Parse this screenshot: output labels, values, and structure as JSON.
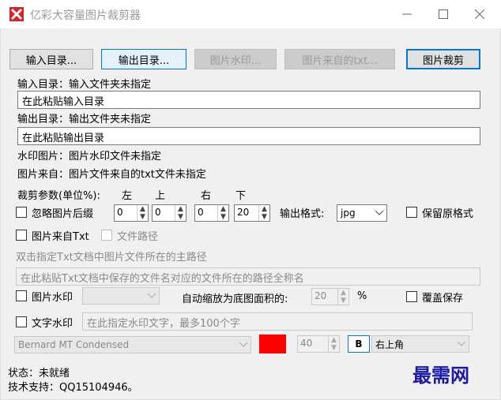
{
  "window": {
    "title": "亿彩大容量图片裁剪器",
    "minimize_icon": "minimize-icon",
    "maximize_icon": "maximize-icon",
    "close_icon": "close-icon"
  },
  "toolbar": {
    "input_dir": "输入目录...",
    "output_dir": "输出目录...",
    "watermark_img": "图片水印...",
    "source_txt": "图片来自的txt...",
    "crop": "图片裁剪"
  },
  "paths": {
    "input_label": "输入目录：输入文件夹未指定",
    "input_value": "在此粘贴输入目录",
    "output_label": "输出目录：输出文件夹未指定",
    "output_value": "在此粘贴输出目录",
    "watermark_label": "水印图片：图片水印文件未指定",
    "source_label": "图片来自：图片文件来自的txt文件未指定"
  },
  "crop": {
    "params_label": "裁剪参数(单位%):",
    "left": "左",
    "top": "上",
    "right": "右",
    "bottom": "下",
    "ignore_suffix": "忽略图片后缀",
    "left_value": "0",
    "top_value": "0",
    "right_value": "0",
    "bottom_value": "20",
    "format_label": "输出格式:",
    "format_value": "jpg",
    "keep_format": "保留原格式"
  },
  "txt_source": {
    "from_txt": "图片来自Txt",
    "file_path": "文件路径",
    "hint": "双击指定Txt文档中图片文件所在的主路径",
    "fullpath_value": "在此粘贴Txt文档中保存的文件名对应的文件所在的路径全称名"
  },
  "watermark": {
    "img_label": "图片水印",
    "scale_label": "自动缩放为底图面积的:",
    "scale_value": "20",
    "percent": "%",
    "overwrite": "覆盖保存",
    "text_label": "文字水印",
    "text_placeholder": "在此指定水印文字，最多100个字",
    "font_value": "Bernard MT Condensed",
    "color": "#ff0000",
    "size_value": "40",
    "bold": "B",
    "position_value": "右上角"
  },
  "status": {
    "state": "状态：未就绪",
    "support": "技术支持：QQ15104946。"
  },
  "brand": {
    "watermark_text": "最需网"
  }
}
